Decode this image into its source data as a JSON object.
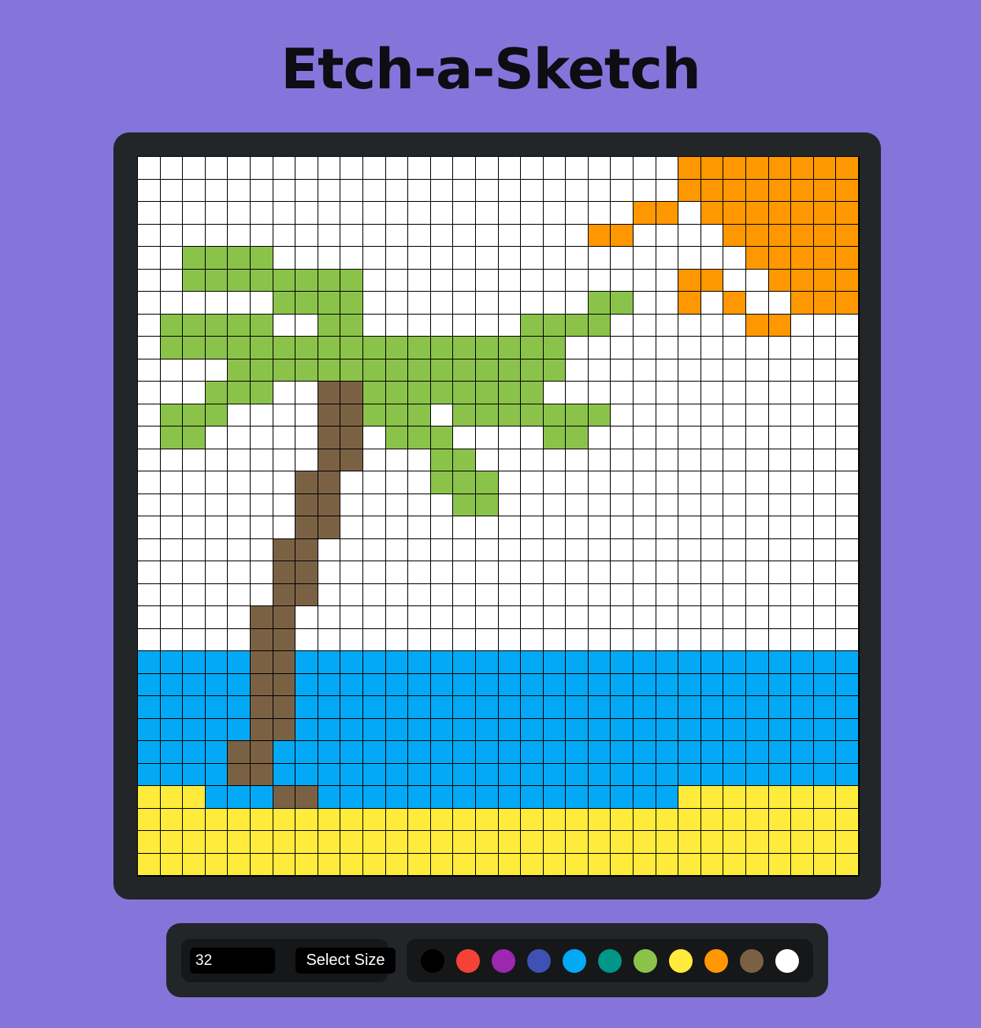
{
  "app": {
    "title": "Etch-a-Sketch"
  },
  "controls": {
    "size_value": "32",
    "select_size_label": "Select Size"
  },
  "palette": [
    {
      "name": "black",
      "color": "#000000"
    },
    {
      "name": "red",
      "color": "#f44336"
    },
    {
      "name": "purple",
      "color": "#9c27b0"
    },
    {
      "name": "indigo",
      "color": "#3f51b5"
    },
    {
      "name": "light-blue",
      "color": "#03a9f4"
    },
    {
      "name": "teal",
      "color": "#009688"
    },
    {
      "name": "light-green",
      "color": "#8bc34a"
    },
    {
      "name": "yellow",
      "color": "#ffeb3b"
    },
    {
      "name": "orange",
      "color": "#ff9800"
    },
    {
      "name": "brown",
      "color": "#7b6144"
    },
    {
      "name": "white",
      "color": "#ffffff"
    }
  ],
  "canvas": {
    "size": 32,
    "colors": {
      ".": "#ffffff",
      "O": "#ff9800",
      "G": "#8bc34a",
      "B": "#7b6144",
      "W": "#03a9f4",
      "Y": "#ffeb3b"
    },
    "rows": [
      "........................OOOOOOOO",
      "........................OOOOOOOO",
      "......................OO.OOOOOOO",
      "....................OO....OOOOOO",
      "..GGGG.....................OOOOO",
      "..GGGGGGGG..............OO..OOOO",
      "......GGGG..........GG..O.O..OOO",
      ".GGGGG..GG.......GGGG......OO...",
      ".GGGGGGGGGGGGGGGGGG.............",
      "....GGGGGGGGGGGGGGG.............",
      "...GGG..BBGGGGGGGG..............",
      ".GGG....BBGGG.GGGGGGG...........",
      ".GG.....BB.GGG....GG............",
      "........BB...GG.................",
      ".......BB....GGG................",
      ".......BB.....GG................",
      ".......BB.......................",
      "......BB........................",
      "......BB........................",
      "......BB........................",
      ".....BB.........................",
      ".....BB.........................",
      "WWWWWBBWWWWWWWWWWWWWWWWWWWWWWWWW",
      "WWWWWBBWWWWWWWWWWWWWWWWWWWWWWWWW",
      "WWWWWBBWWWWWWWWWWWWWWWWWWWWWWWWW",
      "WWWWWBBWWWWWWWWWWWWWWWWWWWWWWWWW",
      "WWWWBBWWWWWWWWWWWWWWWWWWWWWWWWWW",
      "WWWWBBWWWWWWWWWWWWWWWWWWWWWWWWWW",
      "YYYWWWBBWWWWWWWWWWWWWWWWYYYYYYYY",
      "YYYYYYYYYYYYYYYYYYYYYYYYYYYYYYYY",
      "YYYYYYYYYYYYYYYYYYYYYYYYYYYYYYYY",
      "YYYYYYYYYYYYYYYYYYYYYYYYYYYYYYYY"
    ]
  }
}
